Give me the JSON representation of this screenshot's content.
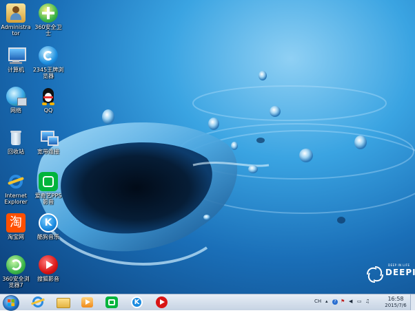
{
  "desktop_icons": [
    {
      "label": "Administrator",
      "icon": "user-folder-icon"
    },
    {
      "label": "360安全卫士",
      "icon": "360-guard-icon"
    },
    {
      "label": "计算机",
      "icon": "computer-icon"
    },
    {
      "label": "2345王牌浏览器",
      "icon": "2345-browser-icon"
    },
    {
      "label": "网络",
      "icon": "network-icon"
    },
    {
      "label": "QQ",
      "icon": "qq-penguin-icon"
    },
    {
      "label": "回收站",
      "icon": "recycle-bin-icon"
    },
    {
      "label": "宽带连接",
      "icon": "broadband-icon"
    },
    {
      "label": "Internet Explorer",
      "icon": "ie-icon"
    },
    {
      "label": "爱奇艺PPS 影音",
      "icon": "iqiyi-icon"
    },
    {
      "label": "淘宝网",
      "icon": "taobao-icon"
    },
    {
      "label": "酷狗音乐",
      "icon": "kugou-icon"
    },
    {
      "label": "360安全浏览器7",
      "icon": "360-browser-icon"
    },
    {
      "label": "搜狐影音",
      "icon": "sohu-video-icon"
    }
  ],
  "branding": {
    "small": "DEEP IN LIFE",
    "big": "DEEPI"
  },
  "taskbar": {
    "pinned": [
      "ie-icon",
      "file-explorer-icon",
      "media-player-icon",
      "iqiyi-icon",
      "kugou-icon",
      "sohu-video-icon"
    ],
    "tray": {
      "lang": "CH",
      "time": "16:58",
      "date": "2015/7/6"
    }
  }
}
